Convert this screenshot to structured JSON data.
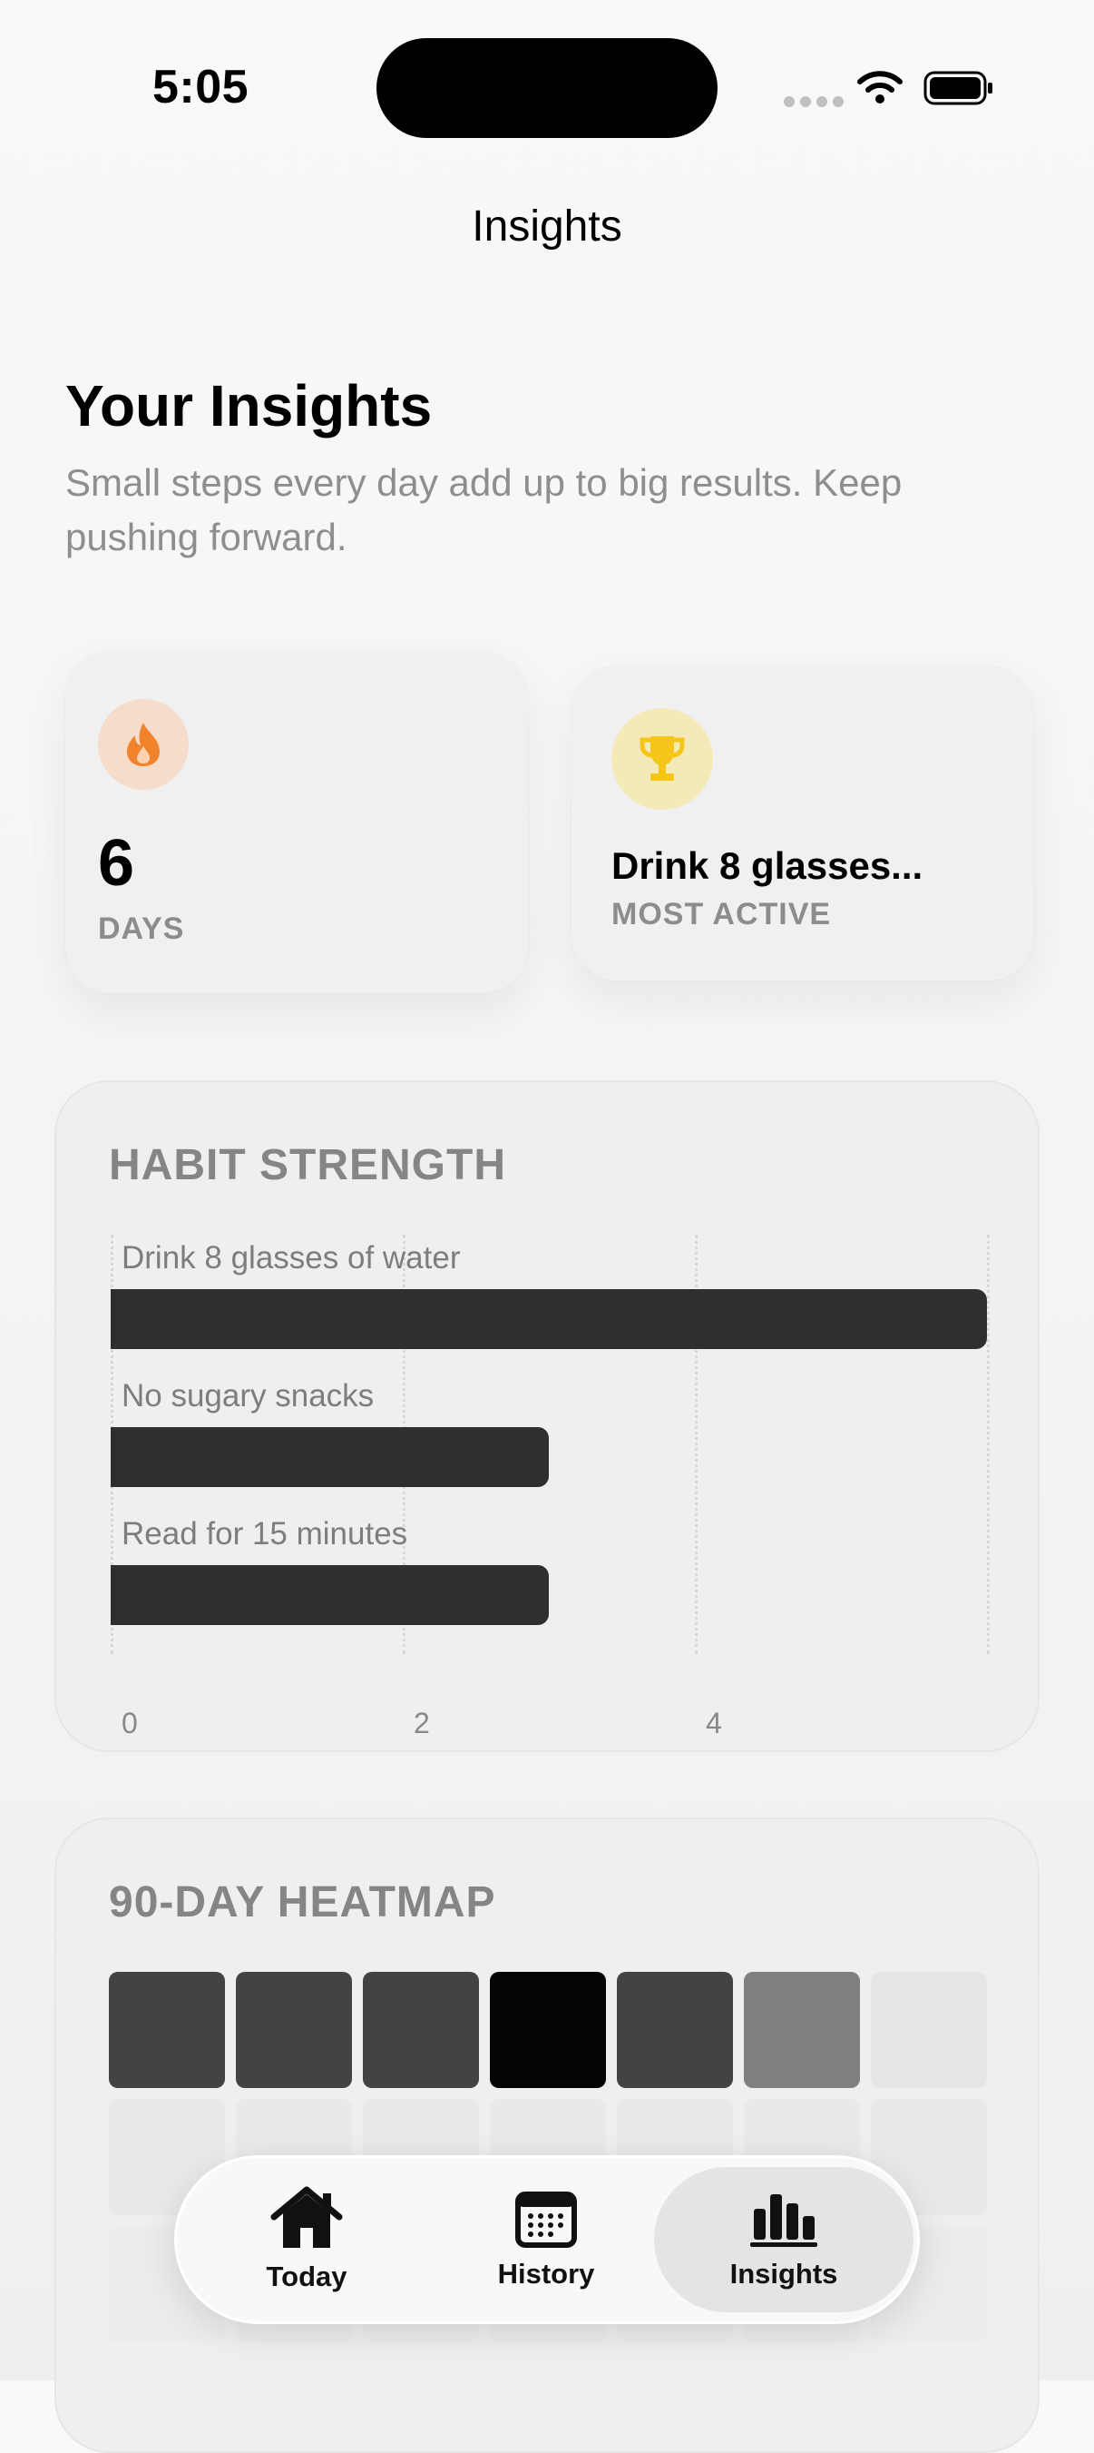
{
  "status_bar": {
    "time": "5:05"
  },
  "nav": {
    "title": "Insights"
  },
  "header": {
    "heading": "Your Insights",
    "subtitle": "Small steps every day add up to big results. Keep pushing forward."
  },
  "stats": {
    "streak": {
      "value": "6",
      "unit": "DAYS",
      "icon": "flame-icon",
      "icon_color": "#f0832b",
      "icon_bg": "#f6dccb"
    },
    "most_active": {
      "habit": "Drink 8 glasses...",
      "label": "MOST ACTIVE",
      "icon": "trophy-icon",
      "icon_color": "#f5c518",
      "icon_bg": "#f4eab7"
    }
  },
  "habit_strength": {
    "title": "HABIT STRENGTH",
    "chart_data": {
      "type": "bar",
      "orientation": "horizontal",
      "categories": [
        "Drink 8 glasses of water",
        "No sugary snacks",
        "Read for 15 minutes"
      ],
      "values": [
        6,
        3,
        3
      ],
      "x_ticks": [
        "0",
        "2",
        "4"
      ],
      "xlim": [
        0,
        6
      ],
      "grid": true,
      "bar_color": "#2f2f2f"
    }
  },
  "heatmap": {
    "title": "90-DAY HEATMAP",
    "rows": [
      [
        "#434343",
        "#434343",
        "#434343",
        "#050505",
        "#434343",
        "#808080",
        "#e6e6e6"
      ],
      [
        "#e9e9e9",
        "#e9e9e9",
        "#e9e9e9",
        "#e9e9e9",
        "#e9e9e9",
        "#e9e9e9",
        "#e9e9e9"
      ],
      [
        "#ececec",
        "#ececec",
        "#ececec",
        "#ececec",
        "#ececec",
        "#ececec",
        "#ececec"
      ]
    ]
  },
  "tabs": [
    {
      "label": "Today",
      "icon": "house-icon",
      "active": false
    },
    {
      "label": "History",
      "icon": "calendar-icon",
      "active": false
    },
    {
      "label": "Insights",
      "icon": "bar-chart-icon",
      "active": true
    }
  ]
}
